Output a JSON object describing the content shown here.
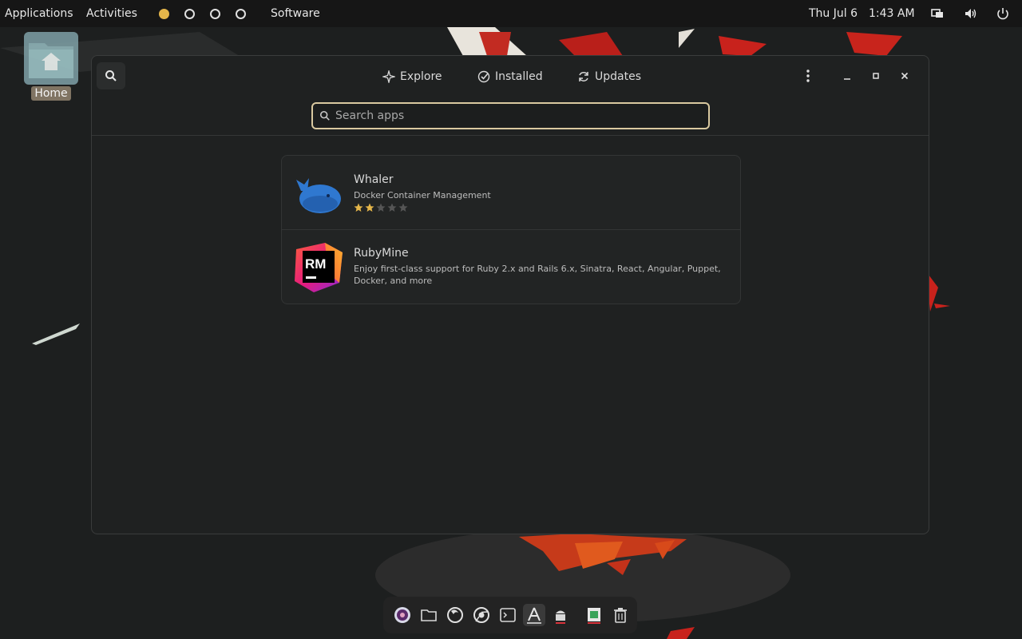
{
  "topbar": {
    "applications_label": "Applications",
    "activities_label": "Activities",
    "app_title": "Software",
    "date": "Thu Jul 6",
    "time": "1:43 AM",
    "workspaces": [
      "active",
      "inactive",
      "inactive",
      "inactive"
    ]
  },
  "desktop": {
    "home_label": "Home"
  },
  "window": {
    "tabs": [
      {
        "label": "Explore",
        "icon": "compass-icon"
      },
      {
        "label": "Installed",
        "icon": "check-circle-icon"
      },
      {
        "label": "Updates",
        "icon": "refresh-icon"
      }
    ],
    "search": {
      "placeholder": "Search apps",
      "value": ""
    },
    "results": [
      {
        "name": "Whaler",
        "description": "Docker Container Management",
        "rating": 2,
        "rating_max": 5,
        "icon": "whale-icon"
      },
      {
        "name": "RubyMine",
        "description": "Enjoy first-class support for Ruby 2.x and Rails 6.x, Sinatra, React, Angular, Puppet, Docker, and more",
        "icon": "rubymine-icon",
        "icon_text": "RM"
      }
    ]
  },
  "dock": {
    "items": [
      "settings-app-icon",
      "files-icon",
      "firefox-icon",
      "chrome-icon",
      "terminal-icon",
      "software-icon",
      "android-icon",
      "spreadsheet-icon",
      "trash-icon"
    ],
    "active_index": 5
  },
  "colors": {
    "accent": "#e5b64a",
    "star_filled": "#e5b64a",
    "star_empty": "#555555",
    "search_border": "#d9c9a0"
  }
}
